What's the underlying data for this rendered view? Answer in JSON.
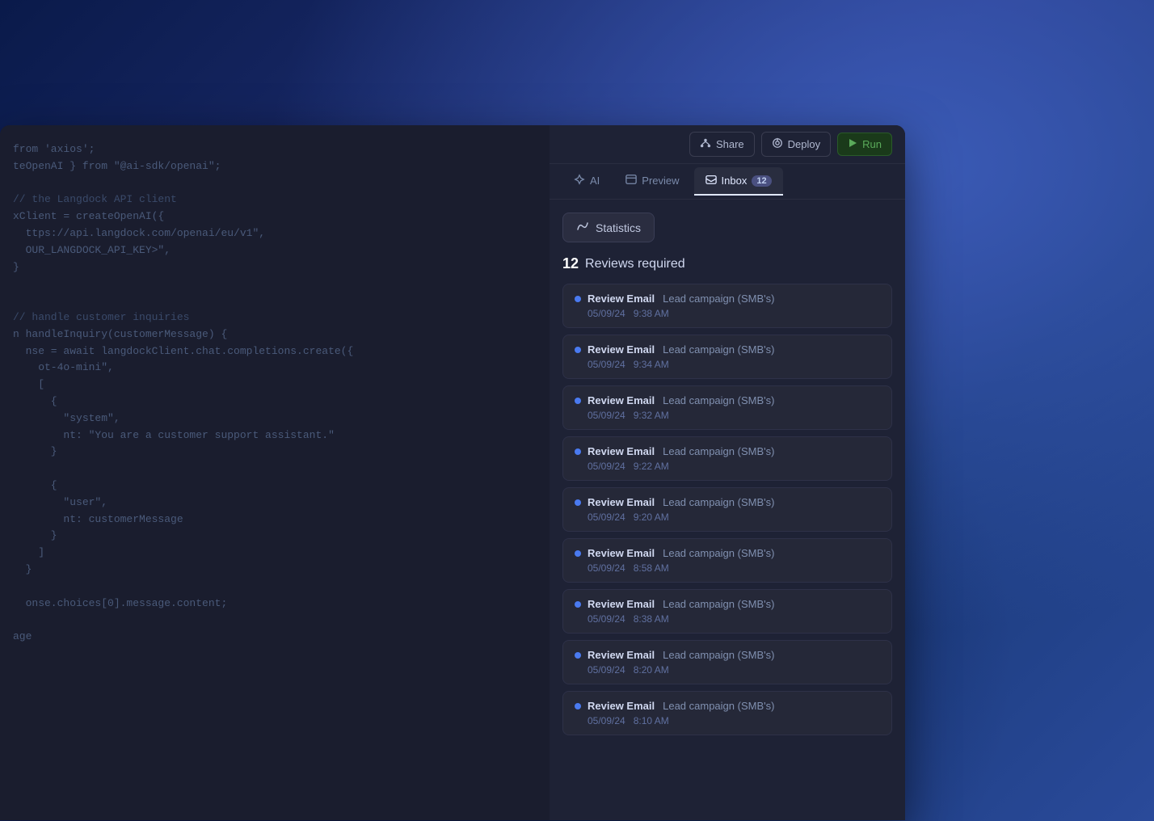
{
  "background": {
    "gradient_start": "#0a1a4a",
    "gradient_end": "#2a4a9a"
  },
  "toolbar": {
    "share_label": "Share",
    "deploy_label": "Deploy",
    "run_label": "Run"
  },
  "tabs": [
    {
      "id": "ai",
      "label": "AI",
      "badge": null,
      "active": false
    },
    {
      "id": "preview",
      "label": "Preview",
      "badge": null,
      "active": false
    },
    {
      "id": "inbox",
      "label": "Inbox",
      "badge": "12",
      "active": true
    }
  ],
  "statistics": {
    "button_label": "Statistics"
  },
  "reviews": {
    "count": "12",
    "label": "Reviews required",
    "items": [
      {
        "title": "Review Email",
        "subtitle": "Lead campaign (SMB's)",
        "date": "05/09/24",
        "time": "9:38 AM"
      },
      {
        "title": "Review Email",
        "subtitle": "Lead campaign (SMB's)",
        "date": "05/09/24",
        "time": "9:34 AM"
      },
      {
        "title": "Review Email",
        "subtitle": "Lead campaign (SMB's)",
        "date": "05/09/24",
        "time": "9:32 AM"
      },
      {
        "title": "Review Email",
        "subtitle": "Lead campaign (SMB's)",
        "date": "05/09/24",
        "time": "9:22 AM"
      },
      {
        "title": "Review Email",
        "subtitle": "Lead campaign (SMB's)",
        "date": "05/09/24",
        "time": "9:20 AM"
      },
      {
        "title": "Review Email",
        "subtitle": "Lead campaign (SMB's)",
        "date": "05/09/24",
        "time": "8:58 AM"
      },
      {
        "title": "Review Email",
        "subtitle": "Lead campaign (SMB's)",
        "date": "05/09/24",
        "time": "8:38 AM"
      },
      {
        "title": "Review Email",
        "subtitle": "Lead campaign (SMB's)",
        "date": "05/09/24",
        "time": "8:20 AM"
      },
      {
        "title": "Review Email",
        "subtitle": "Lead campaign (SMB's)",
        "date": "05/09/24",
        "time": "8:10 AM"
      }
    ]
  },
  "code": {
    "lines": [
      "from 'axios';",
      "teOpenAI } from \"@ai-sdk/openai\";",
      "",
      "// the Langdock API client",
      "xClient = createOpenAI({",
      "  ttps://api.langdock.com/openai/eu/v1\",",
      "  OUR_LANGDOCK_API_KEY>\",",
      "}",
      "",
      "// handle customer inquiries",
      "n handleInquiry(customerMessage) {",
      "  nse = await langdockClient.chat.completions.create({",
      "    ot-4o-mini\",",
      "    [",
      "      {",
      "        \"system\",",
      "        nt: \"You are a customer support assistant.\"",
      "      }",
      "",
      "      {",
      "        \"user\",",
      "        nt: customerMessage",
      "      }",
      "    ]",
      "  }",
      "",
      "  onse.choices[0].message.content;",
      "",
      "age"
    ]
  }
}
